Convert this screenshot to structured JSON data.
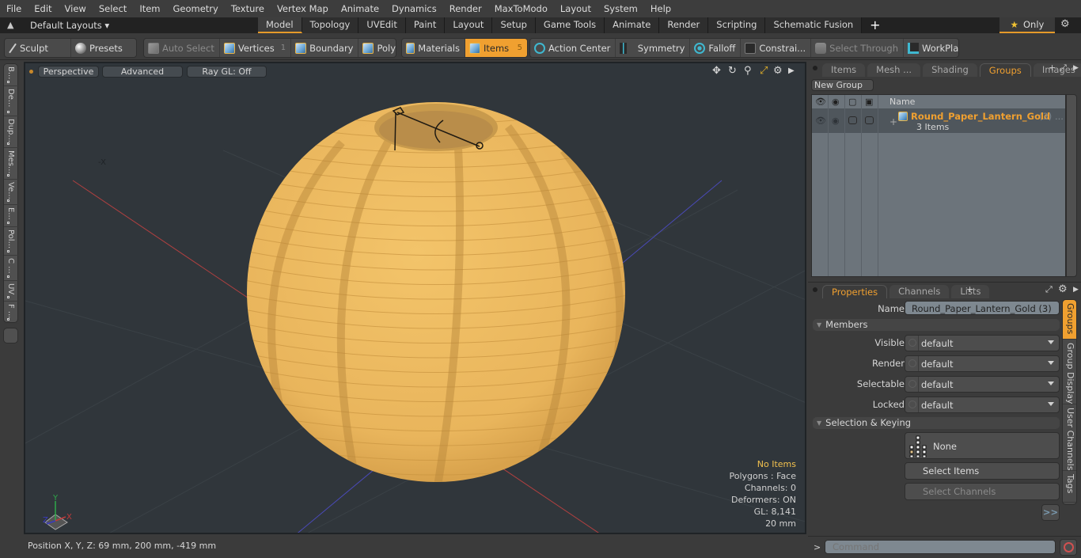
{
  "menu": [
    "File",
    "Edit",
    "View",
    "Select",
    "Item",
    "Geometry",
    "Texture",
    "Vertex Map",
    "Animate",
    "Dynamics",
    "Render",
    "MaxToModo",
    "Layout",
    "System",
    "Help"
  ],
  "layoutbar": {
    "layouts_label": "Default Layouts ▾",
    "tabs": [
      {
        "label": "Model",
        "active": true
      },
      {
        "label": "Topology",
        "active": false
      },
      {
        "label": "UVEdit",
        "active": false
      },
      {
        "label": "Paint",
        "active": false
      },
      {
        "label": "Layout",
        "active": false
      },
      {
        "label": "Setup",
        "active": false
      },
      {
        "label": "Game Tools",
        "active": false
      },
      {
        "label": "Animate",
        "active": false
      },
      {
        "label": "Render",
        "active": false
      },
      {
        "label": "Scripting",
        "active": false
      },
      {
        "label": "Schematic Fusion",
        "active": false
      }
    ],
    "add_tab": "+",
    "only_label": "Only",
    "accent": "#e59a2a"
  },
  "toolbar": {
    "sculpt": "Sculpt",
    "presets": "Presets",
    "auto_select": "Auto Select",
    "vertices": "Vertices",
    "vertices_count": "1",
    "boundary": "Boundary",
    "polygons": "Polygons",
    "materials": "Materials",
    "items": "Items",
    "items_count": "5",
    "action_center": "Action Center",
    "symmetry": "Symmetry",
    "falloff": "Falloff",
    "constraints": "Constrai...",
    "select_through": "Select Through",
    "workplane": "WorkPlane"
  },
  "left_tabs": [
    "B...",
    "De...",
    "Dup...",
    "Mes...",
    "Ve...",
    "E...",
    "Pol...",
    "C ...",
    "UV",
    "F ..."
  ],
  "viewport": {
    "view": "Perspective",
    "shading": "Advanced",
    "raygl": "Ray GL: Off",
    "info": {
      "selection": "No Items",
      "mode": "Polygons : Face",
      "channels": "Channels: 0",
      "deformers": "Deformers: ON",
      "gl": "GL: 8,141",
      "scale": "20 mm"
    },
    "axis_labels": {
      "x": "X",
      "y": "Y",
      "z": "Z"
    },
    "object_color": "#e9b55c"
  },
  "status": {
    "position": "Position X, Y, Z:   69 mm, 200 mm, -419 mm"
  },
  "scene_panel": {
    "tabs": [
      {
        "label": "Items",
        "active": false
      },
      {
        "label": "Mesh ...",
        "active": false
      },
      {
        "label": "Shading",
        "active": false
      },
      {
        "label": "Groups",
        "active": true
      },
      {
        "label": "Images",
        "active": false
      }
    ],
    "new_group": "New Group",
    "column_name": "Name",
    "group": {
      "name": "Round_Paper_Lantern_Gold",
      "count": "(3) ...",
      "subtitle": "3 Items",
      "expand": "+"
    }
  },
  "properties_panel": {
    "tabs": [
      {
        "label": "Properties",
        "active": true
      },
      {
        "label": "Channels",
        "active": false
      },
      {
        "label": "Lists",
        "active": false
      }
    ],
    "name_label": "Name",
    "name_value": "Round_Paper_Lantern_Gold (3)",
    "members_section": "Members",
    "fields": [
      {
        "label": "Visible",
        "value": "default"
      },
      {
        "label": "Render",
        "value": "default"
      },
      {
        "label": "Selectable",
        "value": "default"
      },
      {
        "label": "Locked",
        "value": "default"
      }
    ],
    "selection_section": "Selection & Keying",
    "none_label": "None",
    "select_items": "Select Items",
    "select_channels": "Select Channels",
    "more": ">>",
    "side_tabs": [
      {
        "label": "Groups",
        "active": true
      },
      {
        "label": "Group Display",
        "active": false
      },
      {
        "label": "User Channels",
        "active": false
      },
      {
        "label": "Tags",
        "active": false
      }
    ]
  },
  "command": {
    "prompt": ">",
    "placeholder": "Command"
  }
}
